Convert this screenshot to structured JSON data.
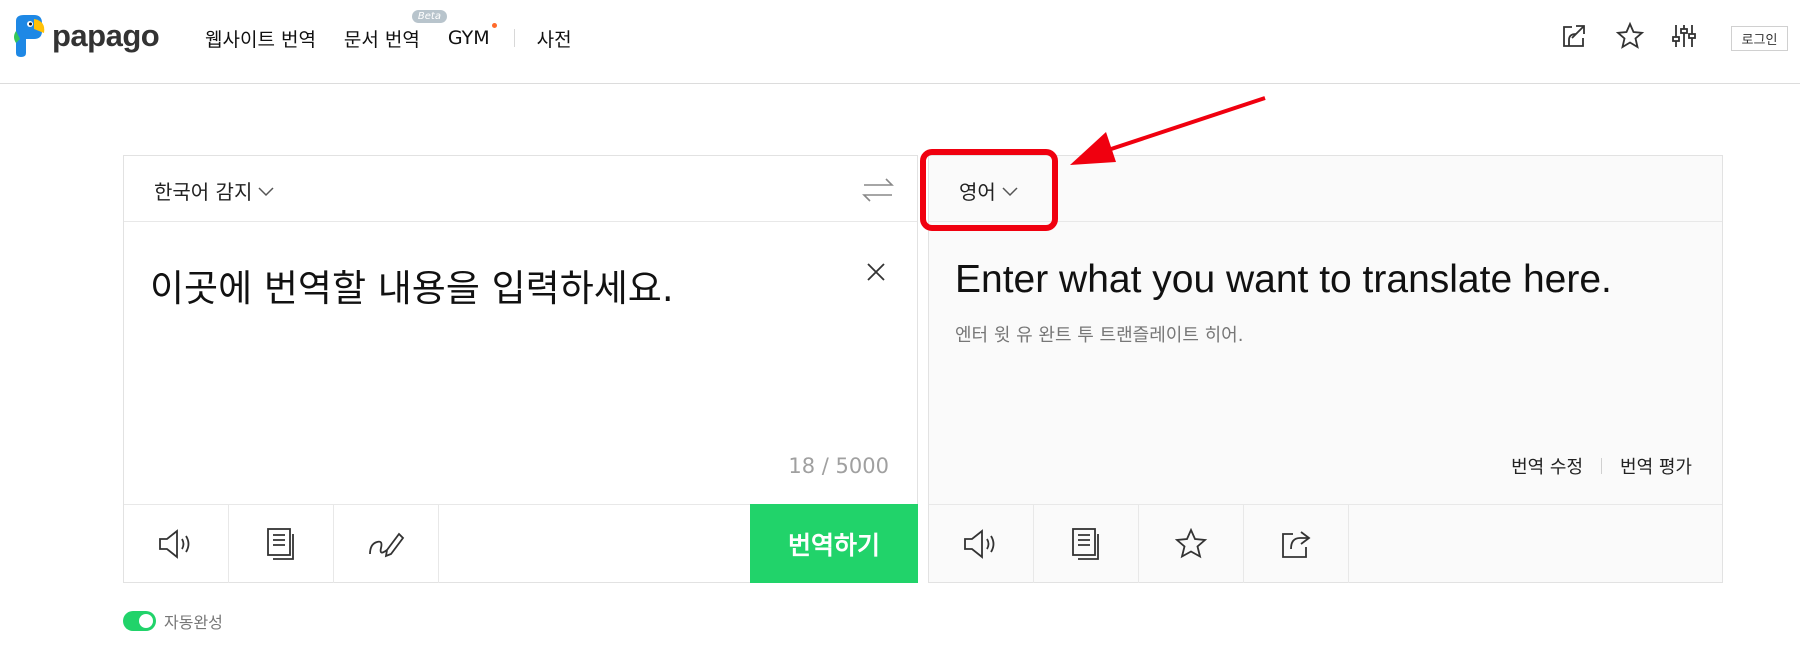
{
  "brand": {
    "name": "papago",
    "colors": {
      "blue": "#1e88e5",
      "yellow": "#ffc107",
      "green": "#21d36a",
      "annotation_red": "#f0000f"
    }
  },
  "nav": {
    "items": [
      {
        "label": "웹사이트 번역"
      },
      {
        "label": "문서 번역",
        "badge": "Beta"
      },
      {
        "label": "GYM"
      },
      {
        "label": "사전"
      }
    ]
  },
  "header_actions": {
    "icons": [
      "open-external-icon",
      "star-icon",
      "settings-sliders-icon"
    ],
    "login_label": "로그인"
  },
  "source": {
    "language": "한국어 감지",
    "text": "이곳에 번역할 내용을 입력하세요.",
    "counter": "18 / 5000",
    "translate_button": "번역하기",
    "tools": [
      "speaker-icon",
      "copy-icon",
      "handwriting-icon"
    ]
  },
  "target": {
    "language": "영어",
    "text": "Enter what you want to translate here.",
    "pronunciation": "엔터 윗 유 완트 투 트랜즐레이트 히어.",
    "edit_label": "번역 수정",
    "rate_label": "번역 평가",
    "tools": [
      "speaker-icon",
      "copy-icon",
      "star-icon",
      "share-icon"
    ]
  },
  "autocomplete": {
    "label": "자동완성",
    "enabled": true
  }
}
